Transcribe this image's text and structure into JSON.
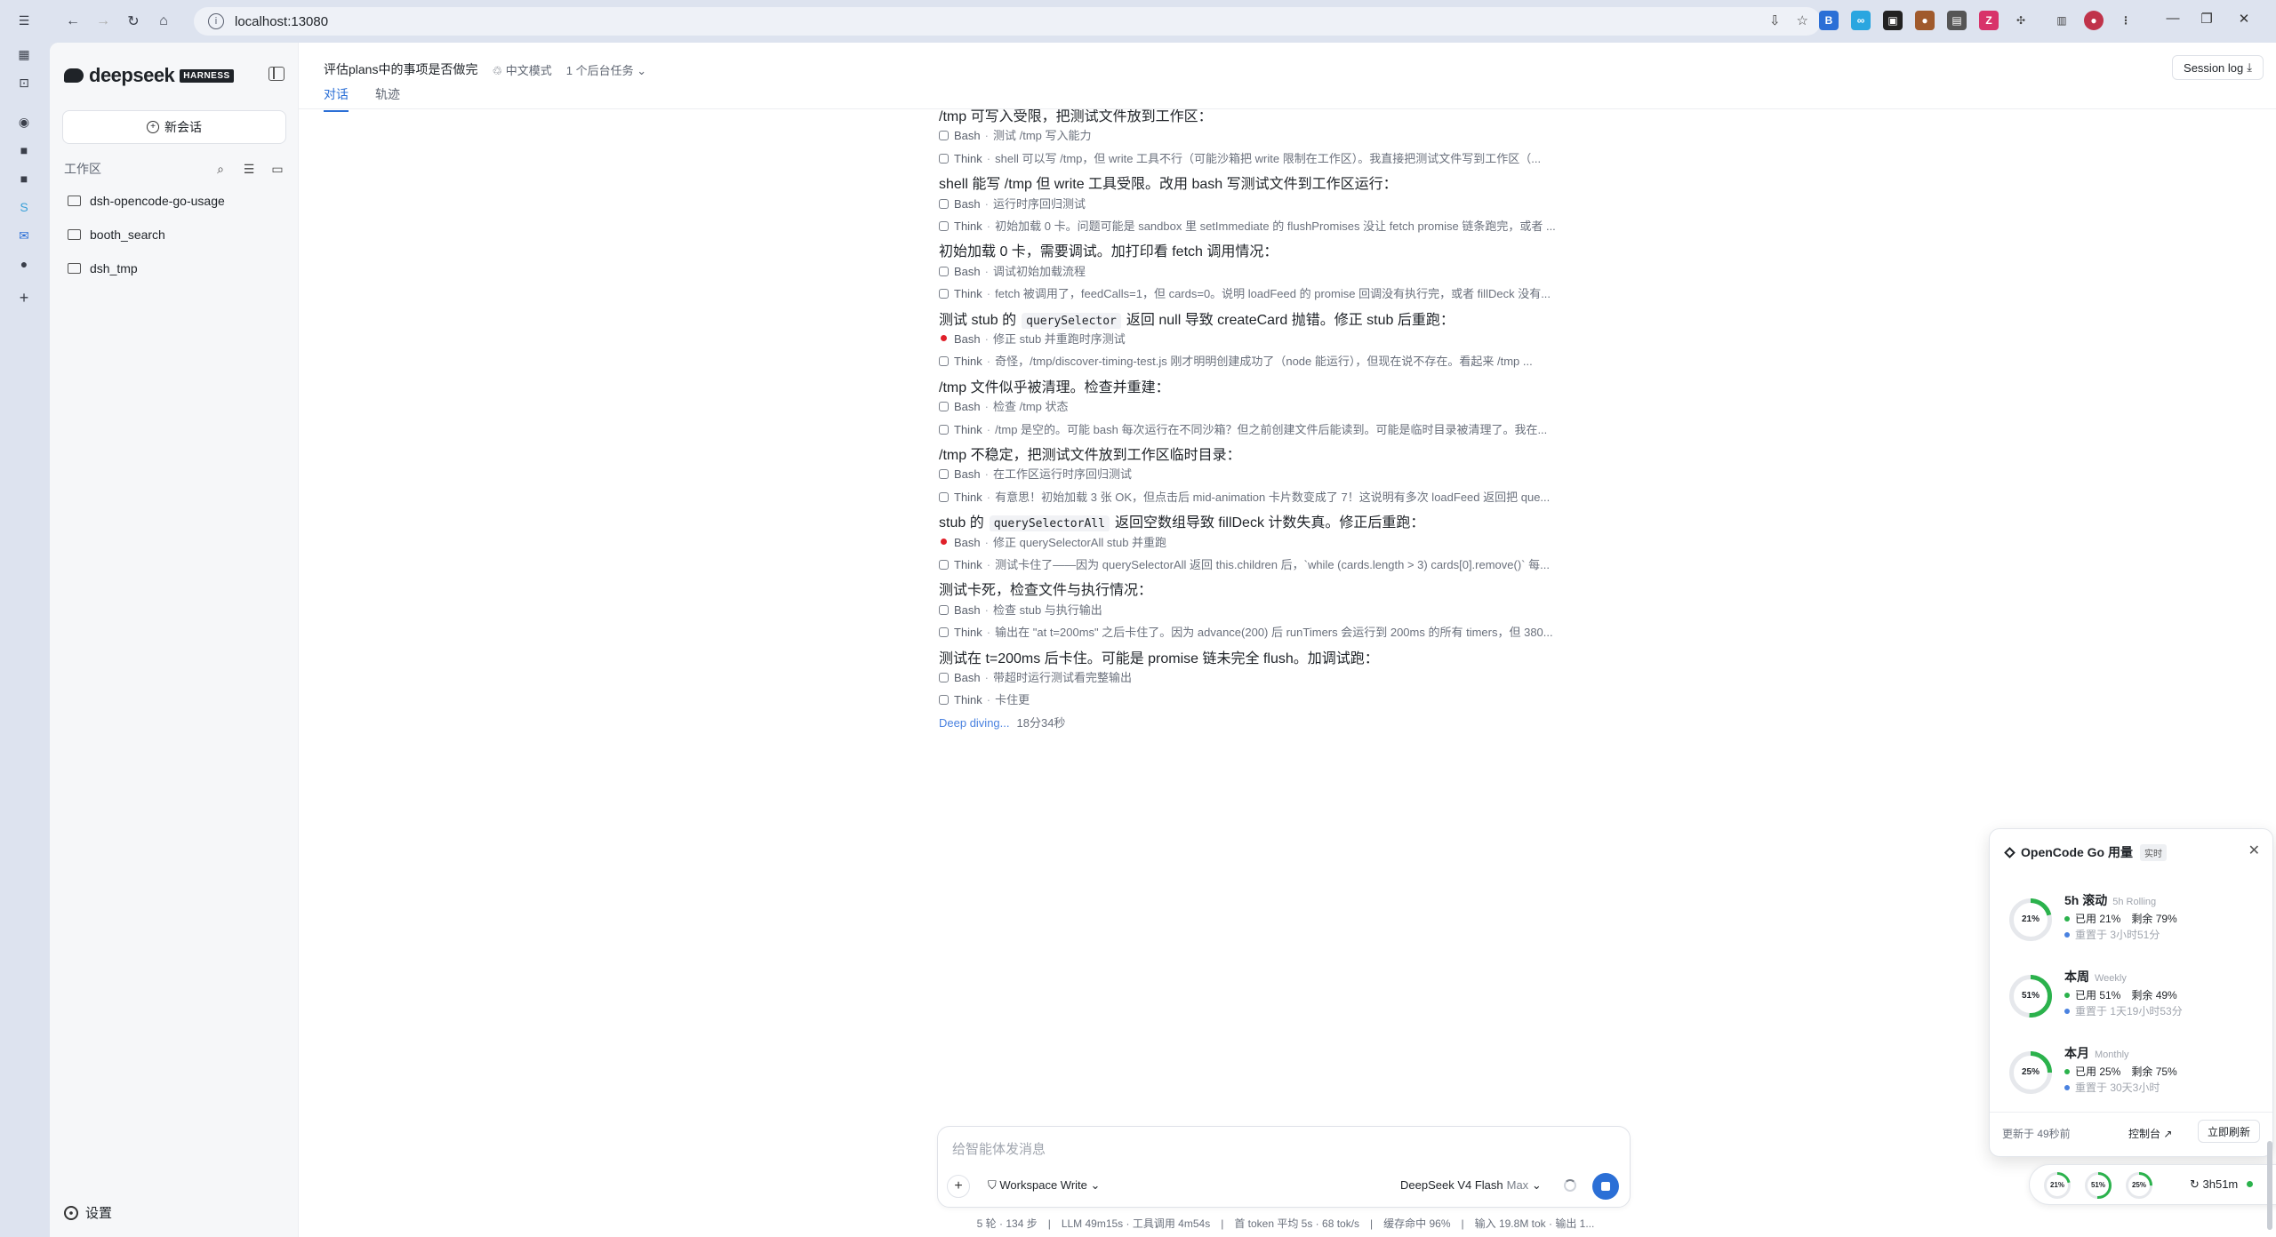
{
  "browser": {
    "url": "localhost:13080"
  },
  "sidebar": {
    "brand": "deepseek",
    "brand_badge": "HARNESS",
    "new_chat_label": "新会话",
    "workspace_label": "工作区",
    "workspaces": [
      {
        "name": "dsh-opencode-go-usage"
      },
      {
        "name": "booth_search"
      },
      {
        "name": "dsh_tmp"
      }
    ],
    "settings_label": "设置"
  },
  "header": {
    "title": "评估plans中的事项是否做完",
    "mode": "中文模式",
    "tasks": "1 个后台任务",
    "tabs": [
      "对话",
      "轨迹"
    ],
    "session_log": "Session log"
  },
  "transcript": [
    {
      "kind": "msg",
      "text": "/tmp 可写入受限，把测试文件放到工作区："
    },
    {
      "kind": "tool",
      "name": "Bash",
      "text": "测试 /tmp 写入能力"
    },
    {
      "kind": "tool",
      "name": "Think",
      "text": "shell 可以写 /tmp，但 write 工具不行（可能沙箱把 write 限制在工作区）。我直接把测试文件写到工作区（..."
    },
    {
      "kind": "msg",
      "text": "shell 能写 /tmp 但 write 工具受限。改用 bash 写测试文件到工作区运行："
    },
    {
      "kind": "tool",
      "name": "Bash",
      "text": "运行时序回归测试"
    },
    {
      "kind": "tool",
      "name": "Think",
      "text": "初始加载 0 卡。问题可能是 sandbox 里 setImmediate 的 flushPromises 没让 fetch promise 链条跑完，或者 ..."
    },
    {
      "kind": "msg",
      "text": "初始加载 0 卡，需要调试。加打印看 fetch 调用情况："
    },
    {
      "kind": "tool",
      "name": "Bash",
      "text": "调试初始加载流程"
    },
    {
      "kind": "tool",
      "name": "Think",
      "text": "fetch 被调用了，feedCalls=1，但 cards=0。说明 loadFeed 的 promise 回调没有执行完，或者 fillDeck 没有..."
    },
    {
      "kind": "msg",
      "pre": "测试 stub 的",
      "code": "querySelector",
      "post": "返回 null 导致 createCard 抛错。修正 stub 后重跑："
    },
    {
      "kind": "tool",
      "name": "Bash",
      "text": "修正 stub 并重跑时序测试",
      "red": true
    },
    {
      "kind": "tool",
      "name": "Think",
      "text": "奇怪，/tmp/discover-timing-test.js 刚才明明创建成功了（node 能运行），但现在说不存在。看起来 /tmp ..."
    },
    {
      "kind": "msg",
      "text": "/tmp 文件似乎被清理。检查并重建："
    },
    {
      "kind": "tool",
      "name": "Bash",
      "text": "检查 /tmp 状态"
    },
    {
      "kind": "tool",
      "name": "Think",
      "text": "/tmp 是空的。可能 bash 每次运行在不同沙箱？但之前创建文件后能读到。可能是临时目录被清理了。我在..."
    },
    {
      "kind": "msg",
      "text": "/tmp 不稳定，把测试文件放到工作区临时目录："
    },
    {
      "kind": "tool",
      "name": "Bash",
      "text": "在工作区运行时序回归测试"
    },
    {
      "kind": "tool",
      "name": "Think",
      "text": "有意思！初始加载 3 张 OK，但点击后 mid-animation 卡片数变成了 7！这说明有多次 loadFeed 返回把 que..."
    },
    {
      "kind": "msg",
      "pre": "stub 的",
      "code": "querySelectorAll",
      "post": "返回空数组导致 fillDeck 计数失真。修正后重跑："
    },
    {
      "kind": "tool",
      "name": "Bash",
      "text": "修正 querySelectorAll stub 并重跑",
      "red": true
    },
    {
      "kind": "tool",
      "name": "Think",
      "text": "测试卡住了——因为 querySelectorAll 返回 this.children 后，`while (cards.length > 3) cards[0].remove()` 每..."
    },
    {
      "kind": "msg",
      "text": "测试卡死，检查文件与执行情况："
    },
    {
      "kind": "tool",
      "name": "Bash",
      "text": "检查 stub 与执行输出"
    },
    {
      "kind": "tool",
      "name": "Think",
      "text": "输出在 \"at t=200ms\" 之后卡住了。因为 advance(200) 后 runTimers 会运行到 200ms 的所有 timers，但 380..."
    },
    {
      "kind": "msg",
      "text": "测试在 t=200ms 后卡住。可能是 promise 链未完全 flush。加调试跑："
    },
    {
      "kind": "tool",
      "name": "Bash",
      "text": "带超时运行测试看完整输出"
    },
    {
      "kind": "tool",
      "name": "Think",
      "text": "卡住更"
    },
    {
      "kind": "deep",
      "text": "Deep diving...",
      "time": "18分34秒"
    }
  ],
  "composer": {
    "placeholder": "给智能体发消息",
    "permission": "Workspace Write",
    "model": "DeepSeek V4 Flash",
    "effort": "Max"
  },
  "status_line": "5 轮 · 134 步　|　LLM 49m15s · 工具调用 4m54s　|　首 token 平均 5s · 68 tok/s　|　缓存命中 96%　|　输入 19.8M tok · 输出 1...",
  "usage": {
    "title": "OpenCode Go 用量",
    "live_badge": "实时",
    "sections": [
      {
        "name": "5h 滚动",
        "en": "5h Rolling",
        "percent": 21,
        "used": "已用 21%",
        "remain": "剩余 79%",
        "reset": "重置于 3小时51分"
      },
      {
        "name": "本周",
        "en": "Weekly",
        "percent": 51,
        "used": "已用 51%",
        "remain": "剩余 49%",
        "reset": "重置于 1天19小时53分"
      },
      {
        "name": "本月",
        "en": "Monthly",
        "percent": 25,
        "used": "已用 25%",
        "remain": "剩余 75%",
        "reset": "重置于 30天3小时"
      }
    ],
    "updated": "更新于 49秒前",
    "console_link": "控制台 ↗",
    "refresh_label": "立即刷新"
  },
  "mini_bar": {
    "percents": [
      "21%",
      "51%",
      "25%"
    ],
    "timer": "↻ 3h51m"
  },
  "colors": {
    "accent": "#2b6fd6",
    "ring_green": "#2bb24c",
    "ring_track": "#e6e8ec",
    "error_dot": "#e0202a"
  }
}
